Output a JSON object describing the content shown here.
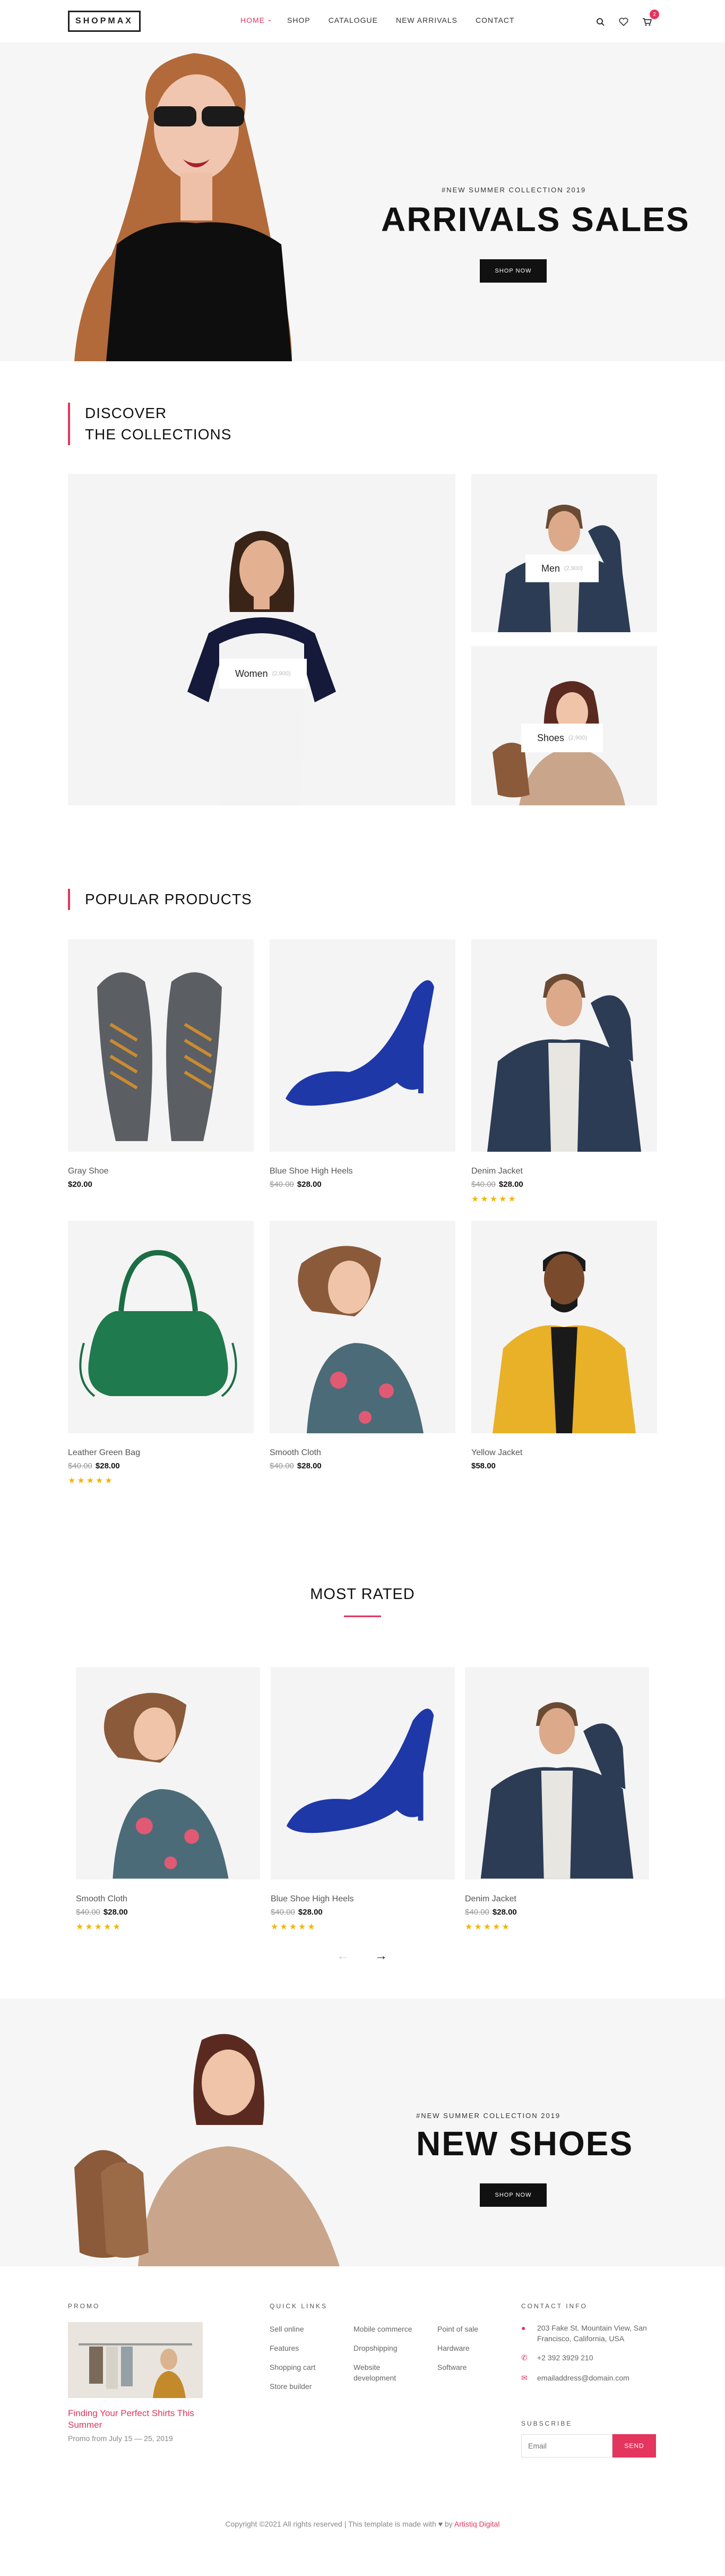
{
  "header": {
    "logo": "SHOPMAX",
    "nav": [
      {
        "label": "HOME",
        "active": true
      },
      {
        "label": "SHOP"
      },
      {
        "label": "CATALOGUE"
      },
      {
        "label": "NEW ARRIVALS"
      },
      {
        "label": "CONTACT"
      }
    ],
    "cart_count": "2"
  },
  "hero": {
    "kicker": "#NEW SUMMER COLLECTION 2019",
    "title": "ARRIVALS SALES",
    "button": "SHOP NOW"
  },
  "collections": {
    "title_line1": "DISCOVER",
    "title_line2": "THE COLLECTIONS",
    "women": {
      "label": "Women",
      "count": "(2,900)"
    },
    "men": {
      "label": "Men",
      "count": "(2,900)"
    },
    "shoes": {
      "label": "Shoes",
      "count": "(2,900)"
    }
  },
  "popular": {
    "title": "POPULAR PRODUCTS",
    "products": [
      {
        "name": "Gray Shoe",
        "old": "",
        "price": "$20.00",
        "stars": ""
      },
      {
        "name": "Blue Shoe High Heels",
        "old": "$40.00",
        "price": "$28.00",
        "stars": ""
      },
      {
        "name": "Denim Jacket",
        "old": "$40.00",
        "price": "$28.00",
        "stars": "★★★★★"
      },
      {
        "name": "Leather Green Bag",
        "old": "$40.00",
        "price": "$28.00",
        "stars": "★★★★★"
      },
      {
        "name": "Smooth Cloth",
        "old": "$40.00",
        "price": "$28.00",
        "stars": ""
      },
      {
        "name": "Yellow Jacket",
        "old": "",
        "price": "$58.00",
        "stars": ""
      }
    ]
  },
  "most_rated": {
    "title": "MOST RATED",
    "products": [
      {
        "name": "Smooth Cloth",
        "old": "$40.00",
        "price": "$28.00",
        "stars": "★★★★★"
      },
      {
        "name": "Blue Shoe High Heels",
        "old": "$40.00",
        "price": "$28.00",
        "stars": "★★★★★"
      },
      {
        "name": "Denim Jacket",
        "old": "$40.00",
        "price": "$28.00",
        "stars": "★★★★★"
      }
    ],
    "prev": "←",
    "next": "→"
  },
  "hero2": {
    "kicker": "#NEW SUMMER COLLECTION 2019",
    "title": "NEW SHOES",
    "button": "SHOP NOW"
  },
  "footer": {
    "promo_title": "PROMO",
    "promo_link": "Finding Your Perfect Shirts This Summer",
    "promo_date": "Promo from July 15 — 25, 2019",
    "quick_title": "QUICK LINKS",
    "col1": [
      "Sell online",
      "Features",
      "Shopping cart",
      "Store builder"
    ],
    "col2": [
      "Mobile commerce",
      "Dropshipping",
      "Website development"
    ],
    "col3": [
      "Point of sale",
      "Hardware",
      "Software"
    ],
    "contact_title": "CONTACT INFO",
    "address": "203 Fake St. Mountain View, San Francisco, California, USA",
    "phone": "+2 392 3929 210",
    "email": "emailaddress@domain.com",
    "subscribe_title": "SUBSCRIBE",
    "email_placeholder": "Email",
    "send": "SEND",
    "copyright": "Copyright ©2021 All rights reserved | This template is made with",
    "by": "by",
    "author": "Artistiq Digital"
  },
  "colors": {
    "accent": "#e3355d",
    "star": "#f2b50f",
    "dark": "#111111"
  }
}
